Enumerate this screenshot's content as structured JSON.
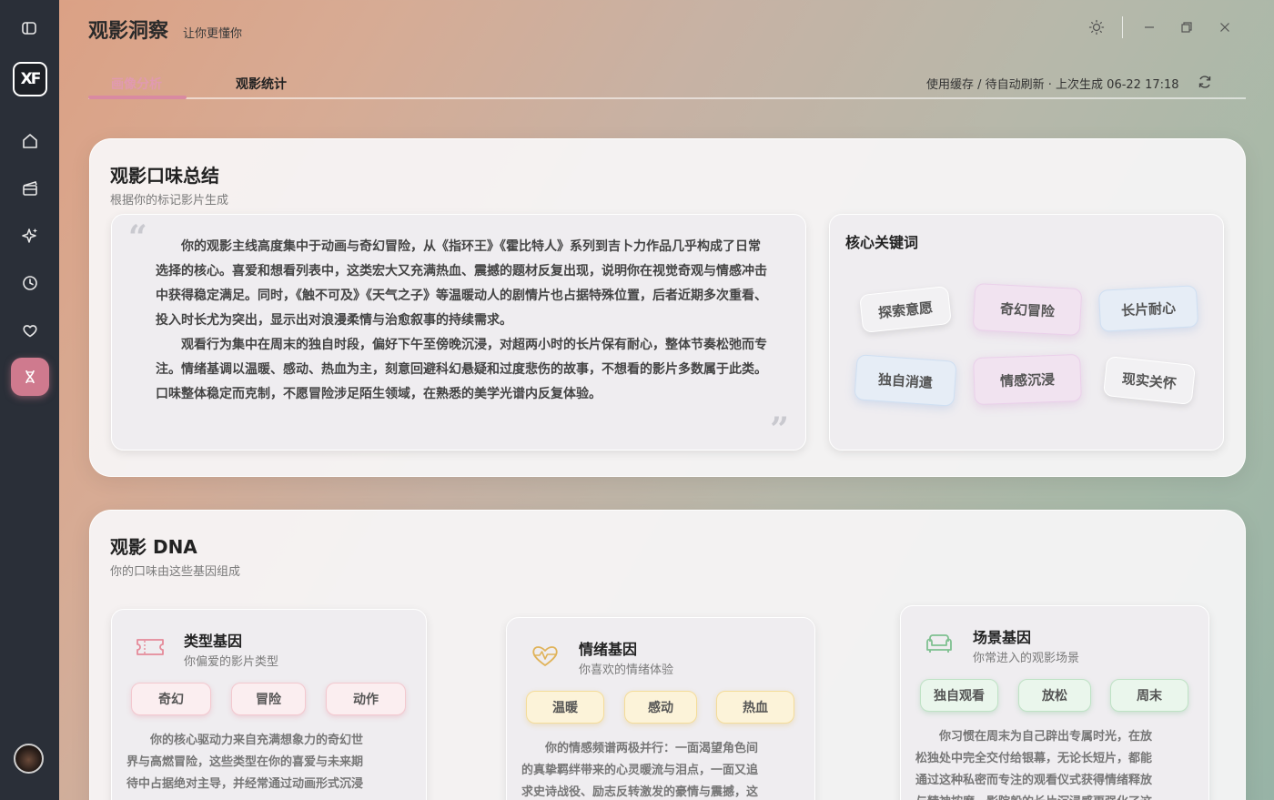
{
  "app": {
    "title": "观影洞察",
    "subtitle": "让你更懂你"
  },
  "sidebar": {
    "logo": "XF",
    "items": [
      {
        "name": "home",
        "icon": "home-icon"
      },
      {
        "name": "movies",
        "icon": "clapperboard-icon"
      },
      {
        "name": "recommend",
        "icon": "sparkle-icon"
      },
      {
        "name": "history",
        "icon": "clock-icon"
      },
      {
        "name": "favorites",
        "icon": "heart-icon"
      },
      {
        "name": "dna",
        "icon": "dna-icon",
        "active": true
      }
    ]
  },
  "tabs": [
    {
      "label": "画像分析",
      "active": true
    },
    {
      "label": "观影统计",
      "active": false
    }
  ],
  "status": {
    "text": "使用缓存 / 待自动刷新 · 上次生成 06-22 17:18"
  },
  "summary": {
    "title": "观影口味总结",
    "subtitle": "根据你的标记影片生成",
    "paragraphs": [
      "你的观影主线高度集中于动画与奇幻冒险，从《指环王》《霍比特人》系列到吉卜力作品几乎构成了日常选择的核心。喜爱和想看列表中，这类宏大又充满热血、震撼的题材反复出现，说明你在视觉奇观与情感冲击中获得稳定满足。同时，《触不可及》《天气之子》等温暖动人的剧情片也占据特殊位置，后者近期多次重看、投入时长尤为突出，显示出对浪漫柔情与治愈叙事的持续需求。",
      "观看行为集中在周末的独自时段，偏好下午至傍晚沉浸，对超两小时的长片保有耐心，整体节奏松弛而专注。情绪基调以温暖、感动、热血为主，刻意回避科幻悬疑和过度悲伤的故事，不想看的影片多数属于此类。口味整体稳定而克制，不愿冒险涉足陌生领域，在熟悉的美学光谱内反复体验。"
    ]
  },
  "keywords": {
    "title": "核心关键词",
    "items": [
      {
        "label": "探索意愿",
        "style": "gray"
      },
      {
        "label": "奇幻冒险",
        "style": "pink"
      },
      {
        "label": "长片耐心",
        "style": "blue"
      },
      {
        "label": "独自消遣",
        "style": "blue"
      },
      {
        "label": "情感沉浸",
        "style": "pink"
      },
      {
        "label": "现实关怀",
        "style": "gray"
      }
    ]
  },
  "dna": {
    "title": "观影 DNA",
    "subtitle": "你的口味由这些基因组成",
    "genes": [
      {
        "title": "类型基因",
        "subtitle": "你偏爱的影片类型",
        "icon": "ticket-icon",
        "color": "#e58a99",
        "chips": [
          "奇幻",
          "冒险",
          "动作"
        ],
        "desc": [
          "你的核心驱动力来自充满想象力的奇幻世",
          "界与高燃冒险，这些类型在你的喜爱与未来期",
          "待中占据绝对主导，并经常通过动画形式沉浸"
        ]
      },
      {
        "title": "情绪基因",
        "subtitle": "你喜欢的情绪体验",
        "icon": "heartbeat-icon",
        "color": "#e0b35a",
        "chips": [
          "温暖",
          "感动",
          "热血"
        ],
        "desc": [
          "你的情感频谱两极并行：一面渴望角色间",
          "的真挚羁绊带来的心灵暖流与泪点，一面又追",
          "求史诗战役、励志反转激发的豪情与震撼，这"
        ]
      },
      {
        "title": "场景基因",
        "subtitle": "你常进入的观影场景",
        "icon": "sofa-icon",
        "color": "#7fc090",
        "chips": [
          "独自观看",
          "放松",
          "周末"
        ],
        "desc": [
          "你习惯在周末为自己辟出专属时光，在放",
          "松独处中完全交付给银幕，无论长短片，都能",
          "通过这种私密而专注的观看仪式获得情绪释放",
          "与精神按摩，影院般的长片沉浸感更强化了这"
        ]
      }
    ]
  }
}
